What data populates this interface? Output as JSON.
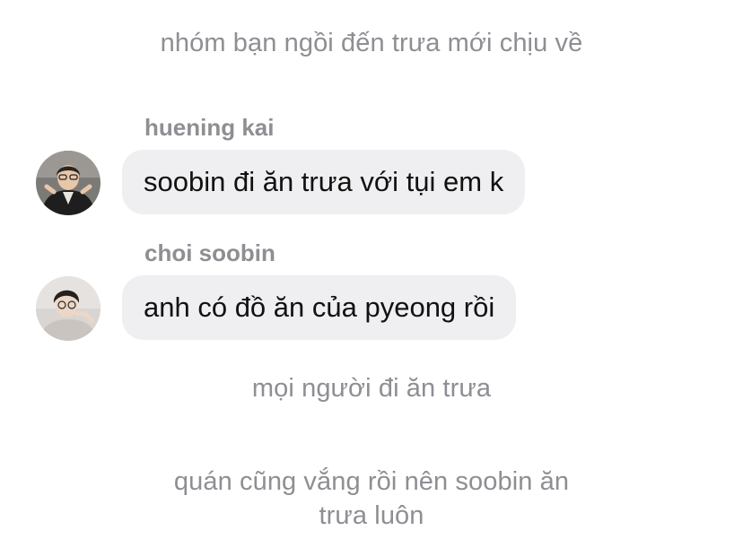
{
  "narration": {
    "top": "nhóm bạn ngồi đến trưa mới chịu về",
    "middle": "mọi người đi ăn trưa",
    "bottom_line1": "quán cũng vắng rồi nên soobin ăn",
    "bottom_line2": "trưa luôn"
  },
  "messages": [
    {
      "sender": "huening kai",
      "text": "soobin đi ăn trưa với tụi em k",
      "avatar_icon": "profile-photo-huening-kai"
    },
    {
      "sender": "choi soobin",
      "text": "anh có đồ ăn của pyeong rồi",
      "avatar_icon": "profile-photo-choi-soobin"
    }
  ],
  "colors": {
    "narration_text": "#8e8e93",
    "sender_text": "#8e8e93",
    "bubble_bg": "#efeff1",
    "bubble_text": "#111111"
  }
}
